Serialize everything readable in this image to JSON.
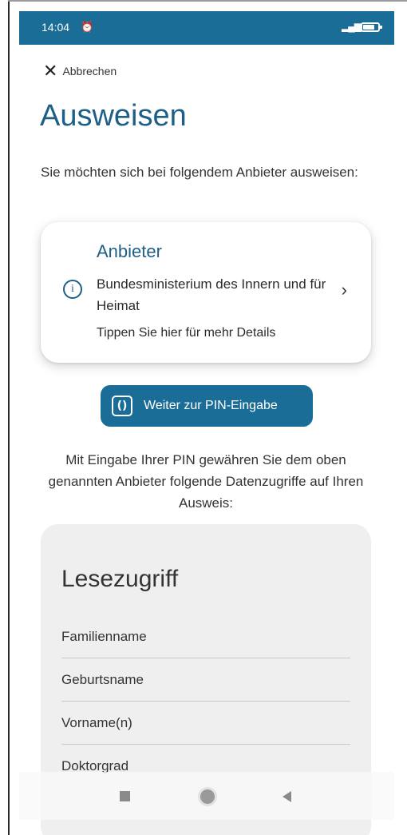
{
  "status_bar": {
    "time": "14:04",
    "alarm_icon": "alarm-off-icon",
    "signal_icon": "signal-icon",
    "battery_icon": "battery-icon"
  },
  "header": {
    "cancel_label": "Abbrechen",
    "close_icon": "close-icon"
  },
  "title": "Ausweisen",
  "intro_text": "Sie möchten sich bei folgendem Anbieter ausweisen:",
  "provider_card": {
    "heading": "Anbieter",
    "name": "Bundesministerium des Innern und für Heimat",
    "hint": "Tippen Sie hier für mehr Details",
    "info_icon": "info-icon",
    "chevron_icon": "chevron-right-icon"
  },
  "pin_button": {
    "label": "Weiter zur PIN-Eingabe",
    "icon": "pin-entry-icon"
  },
  "consent_text": "Mit Eingabe Ihrer PIN gewähren Sie dem oben genannten Anbieter folgende Datenzugriffe auf Ihren Ausweis:",
  "read_access": {
    "title": "Lesezugriff",
    "items": [
      "Familienname",
      "Geburtsname",
      "Vorname(n)",
      "Doktorgrad"
    ]
  },
  "nav_bar": {
    "recents_icon": "recents-icon",
    "home_icon": "home-icon",
    "back_icon": "back-icon"
  },
  "colors": {
    "accent": "#1a6d96",
    "title": "#1d5f86",
    "panel": "#efefef"
  }
}
